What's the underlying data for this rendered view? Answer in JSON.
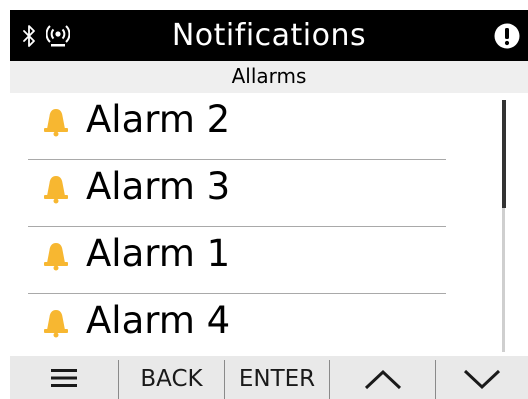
{
  "header": {
    "title": "Notifications",
    "bluetooth_icon": "bluetooth-icon",
    "signal_icon": "wireless-signal-icon",
    "info_icon": "exclamation-info-icon"
  },
  "subheader": {
    "title": "Allarms"
  },
  "alarms": [
    {
      "label": "Alarm 2",
      "icon": "bell-icon"
    },
    {
      "label": "Alarm 3",
      "icon": "bell-icon"
    },
    {
      "label": "Alarm 1",
      "icon": "bell-icon"
    },
    {
      "label": "Alarm 4",
      "icon": "bell-icon"
    }
  ],
  "softkeys": {
    "menu_icon": "hamburger-menu-icon",
    "back": "BACK",
    "enter": "ENTER",
    "up_icon": "chevron-up-icon",
    "down_icon": "chevron-down-icon"
  },
  "colors": {
    "titlebar_bg": "#000000",
    "bell": "#f7b731",
    "subbar_bg": "#efefef",
    "softkey_bg": "#e9e9e9"
  }
}
